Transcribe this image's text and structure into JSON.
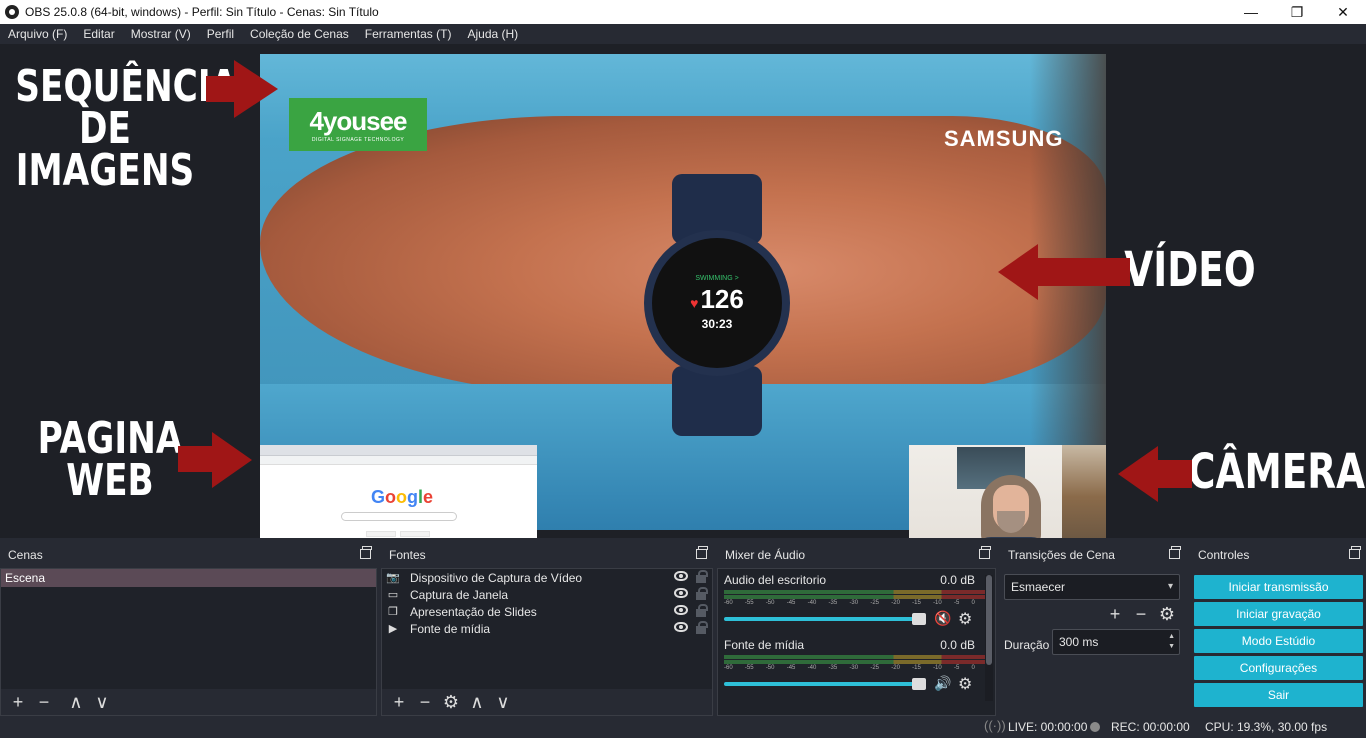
{
  "window": {
    "title": "OBS 25.0.8 (64-bit, windows) - Perfil: Sin Título - Cenas: Sin Título",
    "minimize_icon": "—",
    "maximize_icon": "❐",
    "close_icon": "✕"
  },
  "menu": [
    "Arquivo (F)",
    "Editar",
    "Mostrar (V)",
    "Perfil",
    "Coleção de Cenas",
    "Ferramentas (T)",
    "Ajuda (H)"
  ],
  "preview": {
    "logo_text": "4yousee",
    "logo_subtext": "DIGITAL SIGNAGE TECHNOLOGY",
    "brand_text": "SAMSUNG",
    "watch_activity": "SWIMMING >",
    "watch_heartrate": "126",
    "watch_time": "30:23",
    "google_logo": "Google",
    "annotations": {
      "images": [
        "SEQUÊNCIA",
        "DE IMAGENS"
      ],
      "video": "VÍDEO",
      "web": [
        "PAGINA",
        "WEB"
      ],
      "camera": "CÂMERA"
    },
    "annotation_color": "#a01616"
  },
  "scenes": {
    "title": "Cenas",
    "items": [
      "Escena"
    ]
  },
  "sources": {
    "title": "Fontes",
    "items": [
      {
        "label": "Dispositivo de Captura de Vídeo",
        "icon": "camera-icon"
      },
      {
        "label": "Captura de Janela",
        "icon": "window-icon"
      },
      {
        "label": "Apresentação de Slides",
        "icon": "slides-icon"
      },
      {
        "label": "Fonte de mídia",
        "icon": "play-icon"
      }
    ]
  },
  "mixer": {
    "title": "Mixer de Áudio",
    "channels": [
      {
        "name": "Audio del escritorio",
        "db": "0.0 dB",
        "muted": true
      },
      {
        "name": "Fonte de mídia",
        "db": "0.0 dB",
        "muted": false
      }
    ],
    "ticks": [
      "-60",
      "-55",
      "-50",
      "-45",
      "-40",
      "-35",
      "-30",
      "-25",
      "-20",
      "-15",
      "-10",
      "-5",
      "0"
    ]
  },
  "transitions": {
    "title": "Transições de Cena",
    "selected": "Esmaecer",
    "duration_label": "Duração",
    "duration_value": "300 ms"
  },
  "controls": {
    "title": "Controles",
    "buttons": [
      "Iniciar transmissão",
      "Iniciar gravação",
      "Modo Estúdio",
      "Configurações",
      "Sair"
    ],
    "accent": "#1eb3cf"
  },
  "status": {
    "live": "LIVE: 00:00:00",
    "rec": "REC: 00:00:00",
    "cpu": "CPU: 19.3%, 30.00 fps"
  }
}
